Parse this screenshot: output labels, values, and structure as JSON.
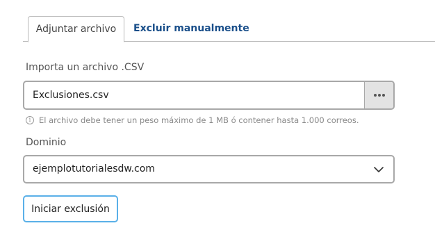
{
  "tabs": [
    {
      "label": "Adjuntar archivo"
    },
    {
      "label": "Excluir manualmente"
    }
  ],
  "file": {
    "label": "Importa un archivo .CSV",
    "value": "Exclusiones.csv",
    "browse_icon": "ellipsis-icon",
    "hint": "El archivo debe tener un peso máximo de 1 MB ó contener hasta 1.000 correos.",
    "hint_icon": "info-icon"
  },
  "domain": {
    "label": "Dominio",
    "value": "ejemplotutorialesdw.com",
    "dropdown_icon": "chevron-down-icon"
  },
  "submit": {
    "label": "Iniciar exclusión"
  },
  "colors": {
    "link": "#1a4f8a",
    "focus_border": "#5ab0e8",
    "border": "#a8a8a8"
  }
}
